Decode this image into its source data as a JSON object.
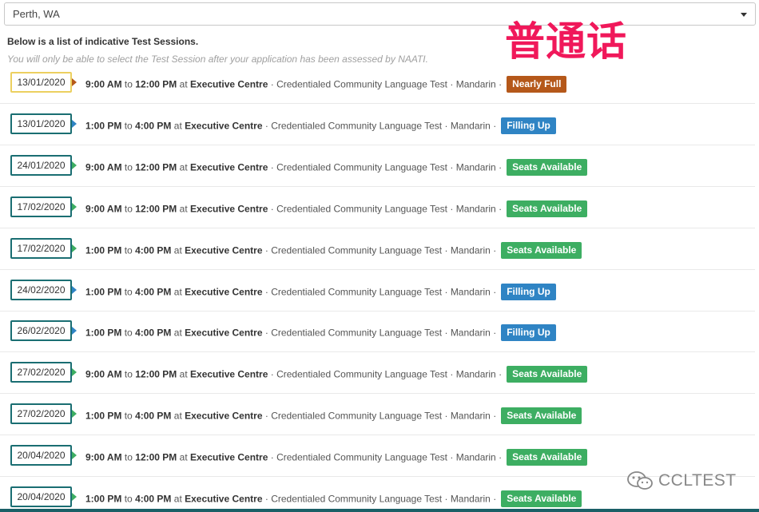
{
  "location": {
    "selected": "Perth, WA"
  },
  "intro": {
    "heading": "Below is a list of indicative Test Sessions.",
    "note": "You will only be able to select the Test Session after your application has been assessed by NAATI."
  },
  "watermark_text": "普通话",
  "brand": {
    "name": "CCLTEST",
    "icon": "wechat-icon"
  },
  "labels": {
    "to": "to",
    "at": "at",
    "sep": "·"
  },
  "colors": {
    "nearly_full": "#b5581a",
    "filling_up": "#2f84c4",
    "seats_available": "#3dae62",
    "date_border_default": "#1a6e72",
    "date_border_highlight": "#ecd060",
    "pointer_seats": "#3dae62",
    "pointer_filling": "#2f84c4",
    "pointer_nearly": "#b5581a"
  },
  "sessions": [
    {
      "date": "13/01/2020",
      "start": "9:00 AM",
      "end": "12:00 PM",
      "venue": "Executive Centre",
      "test": "Credentialed Community Language Test",
      "language": "Mandarin",
      "status": "Nearly Full",
      "kind": "nearly_full",
      "highlight": true
    },
    {
      "date": "13/01/2020",
      "start": "1:00 PM",
      "end": "4:00 PM",
      "venue": "Executive Centre",
      "test": "Credentialed Community Language Test",
      "language": "Mandarin",
      "status": "Filling Up",
      "kind": "filling_up",
      "highlight": false
    },
    {
      "date": "24/01/2020",
      "start": "9:00 AM",
      "end": "12:00 PM",
      "venue": "Executive Centre",
      "test": "Credentialed Community Language Test",
      "language": "Mandarin",
      "status": "Seats Available",
      "kind": "seats_available",
      "highlight": false
    },
    {
      "date": "17/02/2020",
      "start": "9:00 AM",
      "end": "12:00 PM",
      "venue": "Executive Centre",
      "test": "Credentialed Community Language Test",
      "language": "Mandarin",
      "status": "Seats Available",
      "kind": "seats_available",
      "highlight": false
    },
    {
      "date": "17/02/2020",
      "start": "1:00 PM",
      "end": "4:00 PM",
      "venue": "Executive Centre",
      "test": "Credentialed Community Language Test",
      "language": "Mandarin",
      "status": "Seats Available",
      "kind": "seats_available",
      "highlight": false
    },
    {
      "date": "24/02/2020",
      "start": "1:00 PM",
      "end": "4:00 PM",
      "venue": "Executive Centre",
      "test": "Credentialed Community Language Test",
      "language": "Mandarin",
      "status": "Filling Up",
      "kind": "filling_up",
      "highlight": false
    },
    {
      "date": "26/02/2020",
      "start": "1:00 PM",
      "end": "4:00 PM",
      "venue": "Executive Centre",
      "test": "Credentialed Community Language Test",
      "language": "Mandarin",
      "status": "Filling Up",
      "kind": "filling_up",
      "highlight": false
    },
    {
      "date": "27/02/2020",
      "start": "9:00 AM",
      "end": "12:00 PM",
      "venue": "Executive Centre",
      "test": "Credentialed Community Language Test",
      "language": "Mandarin",
      "status": "Seats Available",
      "kind": "seats_available",
      "highlight": false
    },
    {
      "date": "27/02/2020",
      "start": "1:00 PM",
      "end": "4:00 PM",
      "venue": "Executive Centre",
      "test": "Credentialed Community Language Test",
      "language": "Mandarin",
      "status": "Seats Available",
      "kind": "seats_available",
      "highlight": false
    },
    {
      "date": "20/04/2020",
      "start": "9:00 AM",
      "end": "12:00 PM",
      "venue": "Executive Centre",
      "test": "Credentialed Community Language Test",
      "language": "Mandarin",
      "status": "Seats Available",
      "kind": "seats_available",
      "highlight": false
    },
    {
      "date": "20/04/2020",
      "start": "1:00 PM",
      "end": "4:00 PM",
      "venue": "Executive Centre",
      "test": "Credentialed Community Language Test",
      "language": "Mandarin",
      "status": "Seats Available",
      "kind": "seats_available",
      "highlight": false
    }
  ]
}
